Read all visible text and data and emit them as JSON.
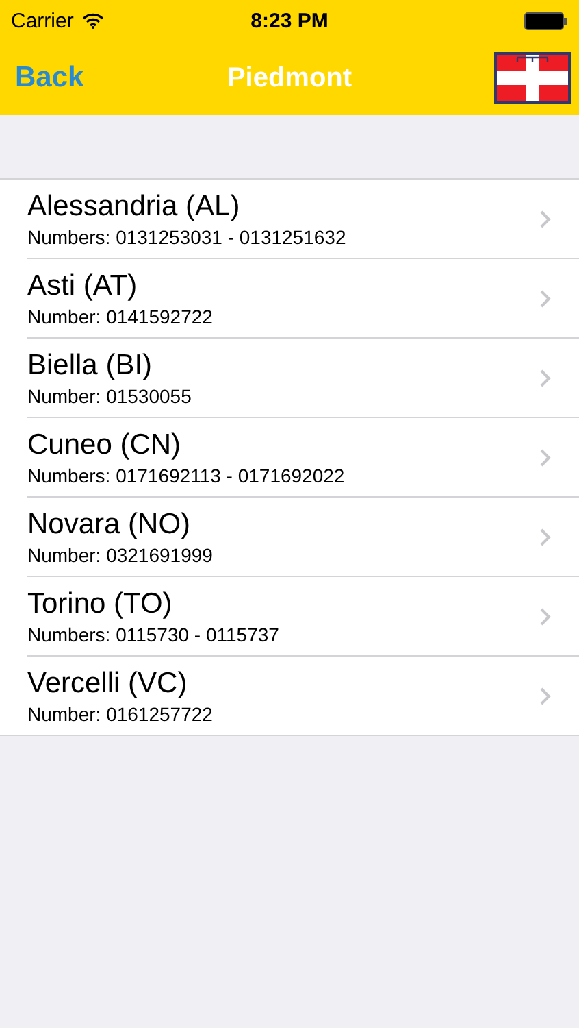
{
  "status_bar": {
    "carrier": "Carrier",
    "time": "8:23 PM"
  },
  "nav_bar": {
    "back": "Back",
    "title": "Piedmont"
  },
  "provinces": [
    {
      "name": "Alessandria (AL)",
      "numbers": "Numbers: 0131253031 - 0131251632"
    },
    {
      "name": "Asti (AT)",
      "numbers": "Number: 0141592722"
    },
    {
      "name": "Biella (BI)",
      "numbers": "Number: 01530055"
    },
    {
      "name": "Cuneo (CN)",
      "numbers": "Numbers: 0171692113 - 0171692022"
    },
    {
      "name": "Novara (NO)",
      "numbers": "Number: 0321691999"
    },
    {
      "name": "Torino (TO)",
      "numbers": "Numbers: 0115730 - 0115737"
    },
    {
      "name": "Vercelli (VC)",
      "numbers": "Number: 0161257722"
    }
  ]
}
